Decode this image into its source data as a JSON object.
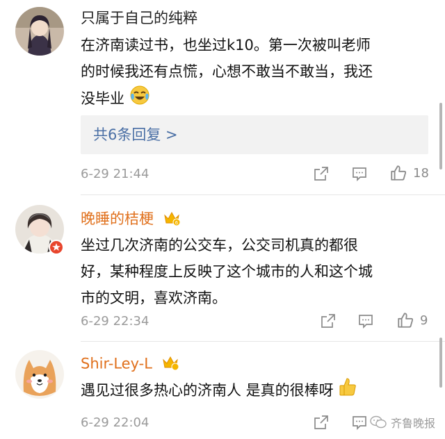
{
  "comments": [
    {
      "username": "只属于自己的纯粹",
      "lines": [
        "在济南读过书，也坐过k10。第一次被叫老师",
        "的时候我还有点慌，心想不敢当不敢当，我还",
        "没毕业"
      ],
      "replies_label": "共6条回复 >",
      "timestamp": "6-29 21:44",
      "likes": "18"
    },
    {
      "username": "晚睡的桔梗",
      "lines": [
        "坐过几次济南的公交车，公交司机真的都很",
        "好，某种程度上反映了这个城市的人和这个城",
        "市的文明，喜欢济南。"
      ],
      "timestamp": "6-29 22:34",
      "likes": "9"
    },
    {
      "username": "Shir-Ley-L",
      "lines": [
        "遇见过很多热心的济南人 是真的很棒呀"
      ],
      "timestamp": "6-29 22:04",
      "likes": ""
    }
  ],
  "watermark": "齐鲁晚报",
  "colors": {
    "username_default": "#222222",
    "username_vip": "#e0701c",
    "link": "#4a6fa5",
    "meta": "#9a9a9a"
  }
}
